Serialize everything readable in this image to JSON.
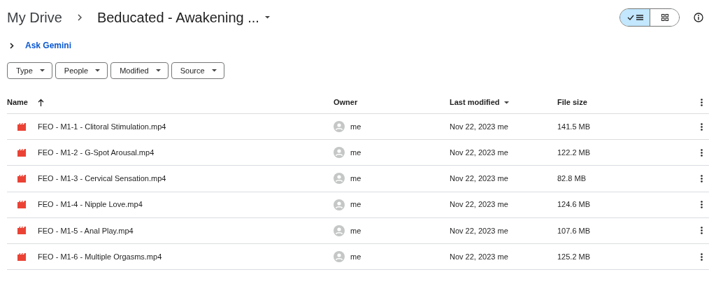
{
  "breadcrumb": [
    {
      "label": "My Drive",
      "current": false
    },
    {
      "label": "Beducated - Awakening ...",
      "current": true
    }
  ],
  "view_toggle": [
    {
      "kind": "list",
      "selected": true
    },
    {
      "kind": "grid",
      "selected": false
    }
  ],
  "ask_gemini": "Ask Gemini",
  "filters": [
    "Type",
    "People",
    "Modified",
    "Source"
  ],
  "table": {
    "columns": [
      {
        "label": "Name",
        "kind": "sorted"
      },
      {
        "label": "Owner",
        "kind": "plain"
      },
      {
        "label": "Last modified",
        "kind": "menu"
      },
      {
        "label": "File size",
        "kind": "plain"
      }
    ],
    "rows": [
      {
        "name": "FEO - M1-1 - Clitoral Stimulation.mp4",
        "owner": "me",
        "modified": "Nov 22, 2023 me",
        "size": "141.5 MB"
      },
      {
        "name": "FEO - M1-2 - G-Spot Arousal.mp4",
        "owner": "me",
        "modified": "Nov 22, 2023 me",
        "size": "122.2 MB"
      },
      {
        "name": "FEO - M1-3 - Cervical Sensation.mp4",
        "owner": "me",
        "modified": "Nov 22, 2023 me",
        "size": "82.8 MB"
      },
      {
        "name": "FEO - M1-4 - Nipple Love.mp4",
        "owner": "me",
        "modified": "Nov 22, 2023 me",
        "size": "124.6 MB"
      },
      {
        "name": "FEO - M1-5 - Anal Play.mp4",
        "owner": "me",
        "modified": "Nov 22, 2023 me",
        "size": "107.6 MB"
      },
      {
        "name": "FEO - M1-6 - Multiple Orgasms.mp4",
        "owner": "me",
        "modified": "Nov 22, 2023 me",
        "size": "125.2 MB"
      }
    ]
  }
}
